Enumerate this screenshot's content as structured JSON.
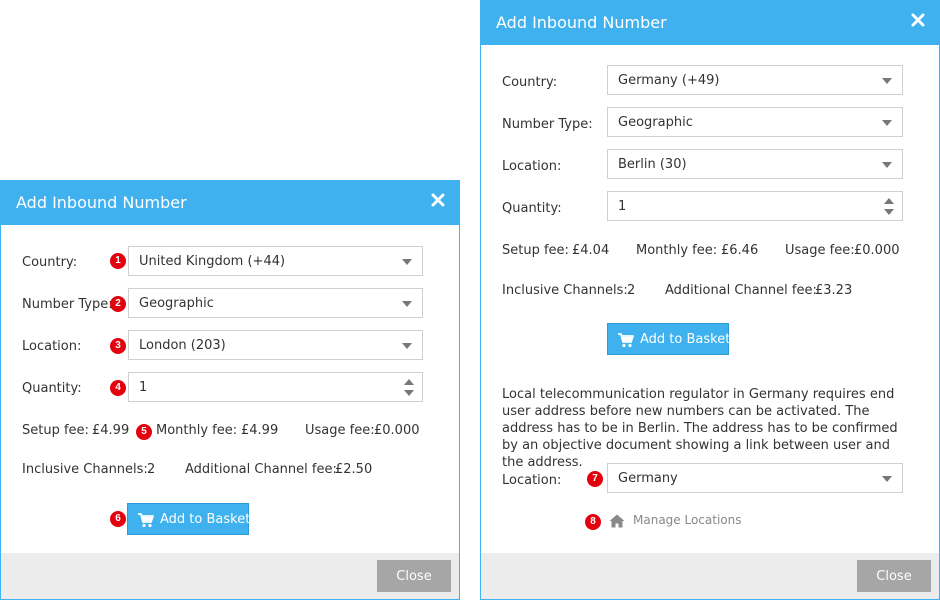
{
  "colors": {
    "accent": "#3eb1ee",
    "badge": "#e3000f",
    "close_button": "#a6a6a6",
    "footer": "#ececec"
  },
  "left_dialog": {
    "title": "Add Inbound Number",
    "country_label": "Country:",
    "country_value": "United Kingdom (+44)",
    "number_type_label": "Number Type:",
    "number_type_value": "Geographic",
    "location_label": "Location:",
    "location_value": "London (203)",
    "quantity_label": "Quantity:",
    "quantity_value": "1",
    "setup_fee_label": "Setup fee:",
    "setup_fee_value": "£4.99",
    "monthly_fee_label": "Monthly fee:",
    "monthly_fee_value": "£4.99",
    "usage_fee_label": "Usage fee:",
    "usage_fee_value": "£0.000",
    "inclusive_channels_label": "Inclusive Channels:",
    "inclusive_channels_value": "2",
    "additional_channel_fee_label": "Additional Channel fee:",
    "additional_channel_fee_value": "£2.50",
    "add_to_basket_label": "Add to Basket",
    "close_label": "Close",
    "badges": [
      "1",
      "2",
      "3",
      "4",
      "5",
      "6"
    ]
  },
  "right_dialog": {
    "title": "Add Inbound Number",
    "country_label": "Country:",
    "country_value": "Germany (+49)",
    "number_type_label": "Number Type:",
    "number_type_value": "Geographic",
    "location_label": "Location:",
    "location_value": "Berlin (30)",
    "quantity_label": "Quantity:",
    "quantity_value": "1",
    "setup_fee_label": "Setup fee:",
    "setup_fee_value": "£4.04",
    "monthly_fee_label": "Monthly fee:",
    "monthly_fee_value": "£6.46",
    "usage_fee_label": "Usage fee:",
    "usage_fee_value": "£0.000",
    "inclusive_channels_label": "Inclusive Channels:",
    "inclusive_channels_value": "2",
    "additional_channel_fee_label": "Additional Channel fee:",
    "additional_channel_fee_value": "£3.23",
    "add_to_basket_label": "Add to Basket",
    "notice_text": "Local telecommunication regulator in Germany requires end user address before new numbers can be activated. The address has to be in Berlin. The address has to be confirmed by an objective document showing a link between user and the address.",
    "address_location_label": "Location:",
    "address_location_value": "Germany",
    "manage_locations_label": "Manage Locations",
    "close_label": "Close",
    "badges": [
      "7",
      "8"
    ]
  }
}
